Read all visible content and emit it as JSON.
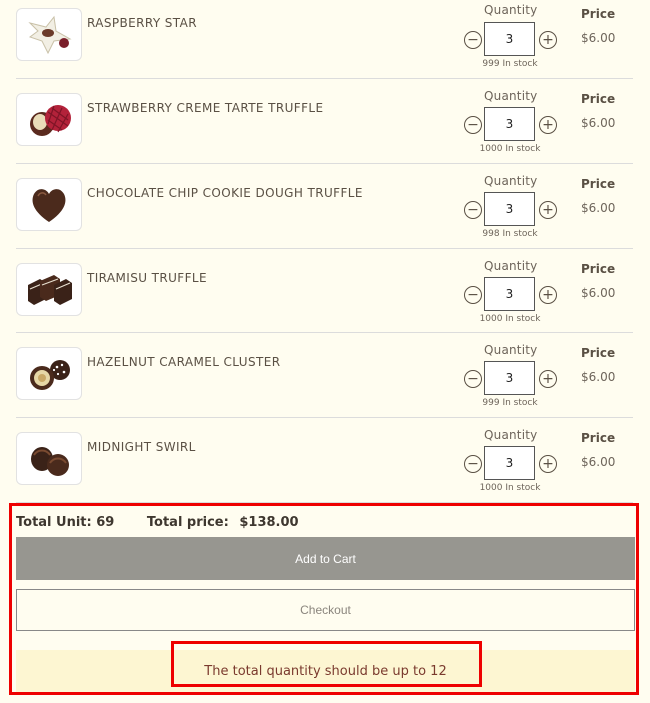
{
  "labels": {
    "quantity": "Quantity",
    "price": "Price"
  },
  "items": [
    {
      "name": "RASPBERRY STAR",
      "qty": "3",
      "stock": "999 In stock",
      "price": "$6.00",
      "icon": "raspberry-star-chocolate-icon"
    },
    {
      "name": "STRAWBERRY CREME TARTE TRUFFLE",
      "qty": "3",
      "stock": "1000 In stock",
      "price": "$6.00",
      "icon": "strawberry-truffle-icon"
    },
    {
      "name": "CHOCOLATE CHIP COOKIE DOUGH TRUFFLE",
      "qty": "3",
      "stock": "998 In stock",
      "price": "$6.00",
      "icon": "heart-chocolate-icon"
    },
    {
      "name": "TIRAMISU TRUFFLE",
      "qty": "3",
      "stock": "1000 In stock",
      "price": "$6.00",
      "icon": "tiramisu-bars-icon"
    },
    {
      "name": "HAZELNUT CARAMEL CLUSTER",
      "qty": "3",
      "stock": "999 In stock",
      "price": "$6.00",
      "icon": "hazelnut-cluster-icon"
    },
    {
      "name": "MIDNIGHT SWIRL",
      "qty": "3",
      "stock": "1000 In stock",
      "price": "$6.00",
      "icon": "midnight-swirl-icon"
    }
  ],
  "summary": {
    "total_unit_label": "Total Unit:",
    "total_unit_value": "69",
    "total_price_label": "Total price:",
    "total_price_value": "$138.00"
  },
  "buttons": {
    "add_to_cart": "Add to Cart",
    "checkout": "Checkout"
  },
  "warning": "The total quantity should be up to 12",
  "colors": {
    "background": "#fffdf0",
    "add_button": "#979690",
    "warning_bg": "#fdf6d2",
    "highlight": "#ee0000"
  }
}
